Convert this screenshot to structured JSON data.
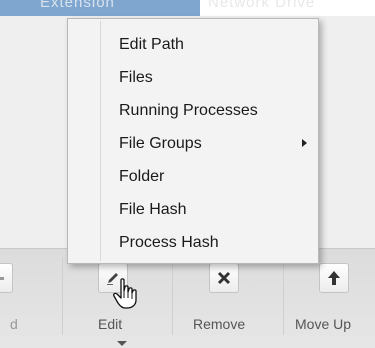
{
  "background_header": {
    "col1_text": "Extension",
    "col2_text": "Network Drive"
  },
  "context_menu": {
    "items": [
      {
        "label": "Edit Path",
        "has_submenu": false
      },
      {
        "label": "Files",
        "has_submenu": false
      },
      {
        "label": "Running Processes",
        "has_submenu": false
      },
      {
        "label": "File Groups",
        "has_submenu": true
      },
      {
        "label": "Folder",
        "has_submenu": false
      },
      {
        "label": "File Hash",
        "has_submenu": false
      },
      {
        "label": "Process Hash",
        "has_submenu": false
      }
    ]
  },
  "toolbar": {
    "add_label": "d",
    "edit_label": "Edit",
    "remove_label": "Remove",
    "move_up_label": "Move Up",
    "add_icon": "plus-icon",
    "edit_icon": "pencil-icon",
    "remove_icon": "x-icon",
    "move_up_icon": "up-arrow-icon"
  },
  "colors": {
    "selected_row": "#7fa6cf",
    "menu_bg": "#f3f3f3",
    "toolbar_bg": "#e0e0e0"
  }
}
